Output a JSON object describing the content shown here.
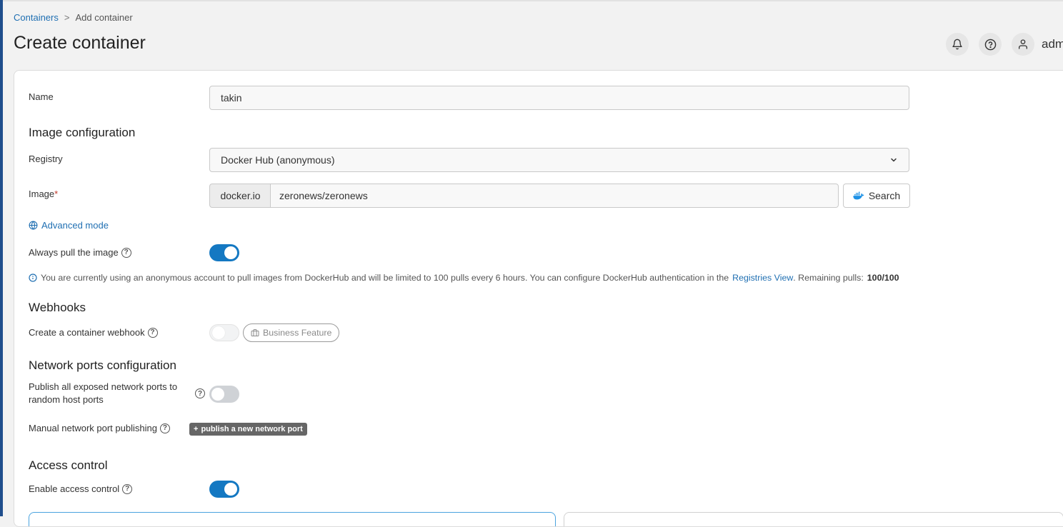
{
  "breadcrumb": {
    "root": "Containers",
    "separator": ">",
    "current": "Add container"
  },
  "page": {
    "title": "Create container"
  },
  "header": {
    "user": "adm"
  },
  "form": {
    "name_label": "Name",
    "name_value": "takin",
    "image_section": "Image configuration",
    "registry_label": "Registry",
    "registry_value": "Docker Hub (anonymous)",
    "image_label": "Image",
    "image_required_mark": "*",
    "image_prefix": "docker.io",
    "image_value": "zeronews/zeronews",
    "search_label": "Search",
    "advanced_mode": "Advanced mode",
    "always_pull_label": "Always pull the image",
    "always_pull_on": true,
    "dockerhub_info": {
      "text_before": "You are currently using an anonymous account to pull images from DockerHub and will be limited to 100 pulls every 6 hours. You can configure DockerHub authentication in the",
      "link": "Registries View",
      "text_after": ". Remaining pulls:",
      "remaining": "100/100"
    },
    "webhooks_section": "Webhooks",
    "webhook_label": "Create a container webhook",
    "business_feature": "Business Feature",
    "network_section": "Network ports configuration",
    "publish_all_label": "Publish all exposed network ports to random host ports",
    "publish_all_on": false,
    "manual_publish_label": "Manual network port publishing",
    "publish_new_port": "publish a new network port",
    "access_section": "Access control",
    "enable_access_label": "Enable access control",
    "enable_access_on": true
  },
  "colors": {
    "accent": "#1478c2",
    "link": "#1f6fb2",
    "rail": "#1f4e8c"
  }
}
